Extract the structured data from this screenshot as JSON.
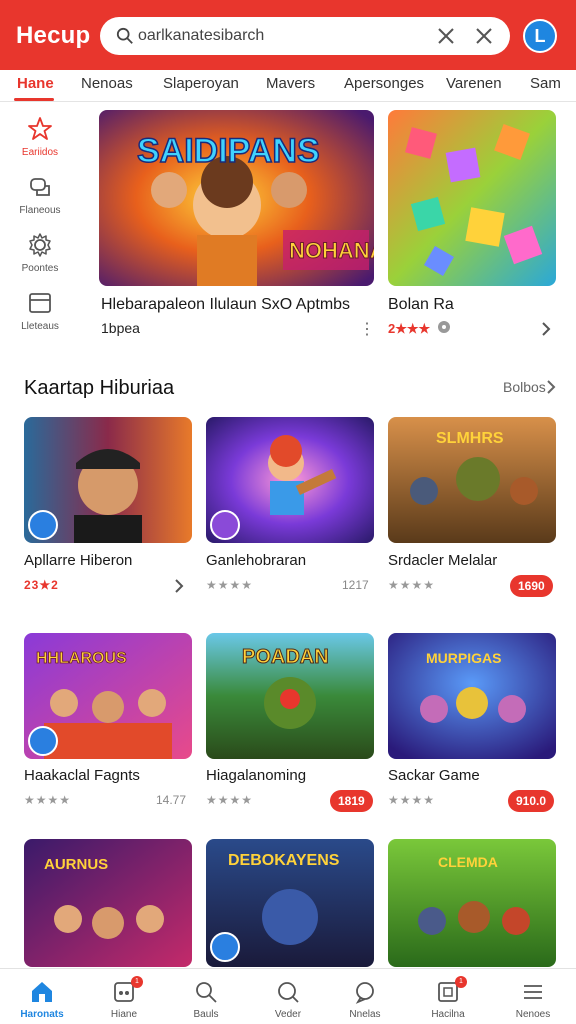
{
  "app": {
    "logo": "Hecup"
  },
  "search": {
    "value": "oarlkanatesibarch",
    "placeholder": ""
  },
  "profile": {
    "avatar_letter": "L"
  },
  "tabs": [
    {
      "label": "Hane",
      "active": true
    },
    {
      "label": "Nenoas"
    },
    {
      "label": "Slaperoyan"
    },
    {
      "label": "Mavers"
    },
    {
      "label": "Apersonges"
    },
    {
      "label": "Varenen"
    },
    {
      "label": "Sam"
    }
  ],
  "rail": [
    {
      "label": "Eariidos",
      "icon": "star-icon",
      "active": true
    },
    {
      "label": "Flaneous",
      "icon": "chat-icon"
    },
    {
      "label": "Poontes",
      "icon": "gear-icon"
    },
    {
      "label": "Lleteaus",
      "icon": "calendar-icon"
    }
  ],
  "featured": [
    {
      "title": "Hlebarapaleon Ilulaun SxO Aptmbs",
      "subtitle": "1bpea"
    },
    {
      "title": "Bolan Ra",
      "rating": "2★★★"
    }
  ],
  "section": {
    "title": "Kaartap Hiburiaa",
    "more": "Bolbos"
  },
  "cards": [
    {
      "title": "Apllarre Hiberon",
      "rating": "23★2",
      "badge": ""
    },
    {
      "title": "Ganlehobraran",
      "rating": "★★★★",
      "meta": "1217"
    },
    {
      "title": "Srdacler Melalar",
      "rating": "★★★★",
      "badge": "1690"
    },
    {
      "title": "Haakaclal Fagnts",
      "rating": "★★★★",
      "meta": "14.77"
    },
    {
      "title": "Hiagalanoming",
      "rating": "★★★★",
      "badge": "1819"
    },
    {
      "title": "Sackar Game",
      "rating": "★★★★",
      "badge": "910.0"
    },
    {
      "title": ""
    },
    {
      "title": ""
    },
    {
      "title": ""
    }
  ],
  "bottom_nav": [
    {
      "label": "Haronats",
      "icon": "home-icon",
      "active": true
    },
    {
      "label": "Hiane",
      "icon": "gamepad-icon",
      "badge": "1"
    },
    {
      "label": "Bauls",
      "icon": "search-icon"
    },
    {
      "label": "Veder",
      "icon": "search-icon"
    },
    {
      "label": "Nnelas",
      "icon": "chat-icon"
    },
    {
      "label": "Hacilna",
      "icon": "calendar-icon",
      "badge": "1"
    },
    {
      "label": "Nenoes",
      "icon": "menu-icon"
    }
  ],
  "colors": {
    "accent": "#e8362d",
    "link": "#1f86e0"
  }
}
